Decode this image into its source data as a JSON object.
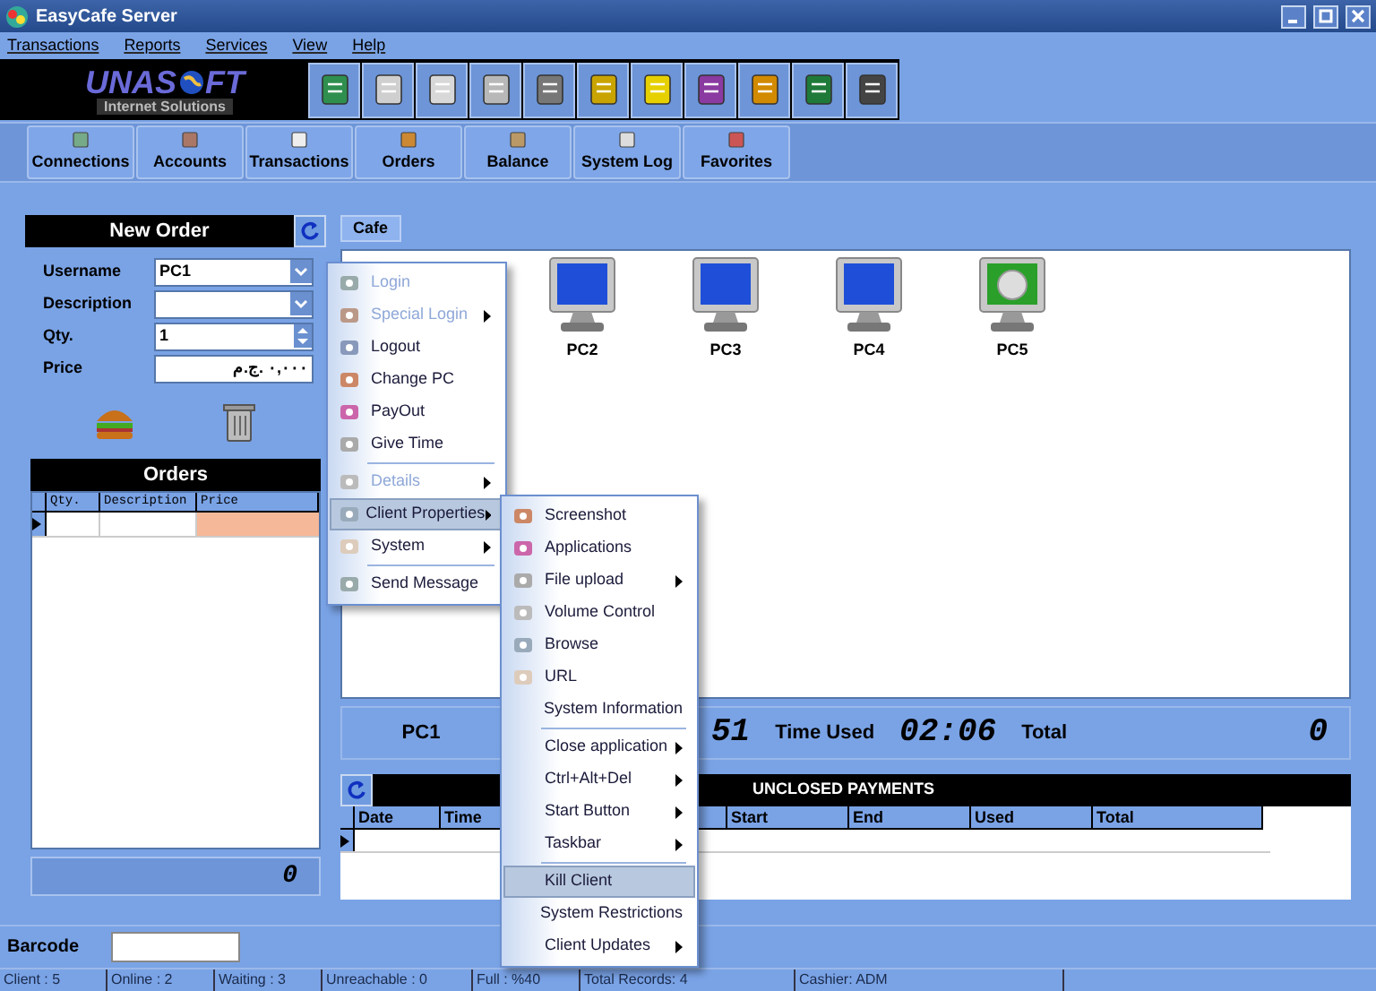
{
  "window": {
    "title": "EasyCafe Server"
  },
  "menu_bar": [
    "Transactions",
    "Reports",
    "Services",
    "View",
    "Help"
  ],
  "logo": {
    "left": "UNAS",
    "right": "FT",
    "tagline": "Internet Solutions"
  },
  "nav_tabs": [
    "Connections",
    "Accounts",
    "Transactions",
    "Orders",
    "Balance",
    "System Log",
    "Favorites"
  ],
  "new_order": {
    "title": "New Order",
    "fields": [
      {
        "label": "Username",
        "value": "PC1",
        "kind": "dropdown"
      },
      {
        "label": "Description",
        "kind": "dropdown"
      },
      {
        "label": "Qty.",
        "value": "1",
        "kind": "spinner"
      },
      {
        "label": "Price",
        "value": "٠,٠٠٠ .ج.م",
        "kind": "text"
      }
    ]
  },
  "orders": {
    "title": "Orders",
    "columns": [
      "Qty.",
      "Description",
      "Price"
    ],
    "total": "0"
  },
  "barcode": {
    "label": "Barcode"
  },
  "cafe": {
    "tab": "Cafe",
    "computers": [
      {
        "name": "PC2",
        "kind": "idle"
      },
      {
        "name": "PC3",
        "kind": "idle"
      },
      {
        "name": "PC4",
        "kind": "idle"
      },
      {
        "name": "PC5",
        "kind": "timer"
      }
    ]
  },
  "info_bar": {
    "name": "PC1",
    "time_partial": "51",
    "time_used_label": "Time Used",
    "time_used": "02:06",
    "total_label": "Total",
    "total": "0"
  },
  "unclosed_payments": {
    "title": "UNCLOSED PAYMENTS",
    "columns": [
      {
        "label": "Date"
      },
      {
        "label": "Time"
      },
      {
        "label": "Start"
      },
      {
        "label": "End"
      },
      {
        "label": "Used"
      },
      {
        "label": "Total"
      }
    ]
  },
  "context_menu": [
    {
      "kind": "item",
      "label": "Login",
      "disabled": true,
      "submenu": false,
      "selected": false
    },
    {
      "kind": "item",
      "label": "Special Login",
      "disabled": true,
      "submenu": true,
      "selected": false
    },
    {
      "kind": "item",
      "label": "Logout",
      "disabled": false,
      "submenu": false,
      "selected": false
    },
    {
      "kind": "item",
      "label": "Change PC",
      "disabled": false,
      "submenu": false,
      "selected": false
    },
    {
      "kind": "item",
      "label": "PayOut",
      "disabled": false,
      "submenu": false,
      "selected": false
    },
    {
      "kind": "item",
      "label": "Give Time",
      "disabled": false,
      "submenu": false,
      "selected": false
    },
    {
      "kind": "separator"
    },
    {
      "kind": "item",
      "label": "Details",
      "disabled": true,
      "submenu": true,
      "selected": false
    },
    {
      "kind": "item",
      "label": "Client Properties",
      "disabled": false,
      "submenu": true,
      "selected": true
    },
    {
      "kind": "item",
      "label": "System",
      "disabled": false,
      "submenu": true,
      "selected": false
    },
    {
      "kind": "separator"
    },
    {
      "kind": "item",
      "label": "Send Message",
      "disabled": false,
      "submenu": false,
      "selected": false
    }
  ],
  "submenu": [
    {
      "kind": "item",
      "label": "Screenshot",
      "submenu": false,
      "selected": false
    },
    {
      "kind": "item",
      "label": "Applications",
      "submenu": false,
      "selected": false
    },
    {
      "kind": "item",
      "label": "File upload",
      "submenu": true,
      "selected": false
    },
    {
      "kind": "item",
      "label": "Volume Control",
      "submenu": false,
      "selected": false
    },
    {
      "kind": "item",
      "label": "Browse",
      "submenu": false,
      "selected": false
    },
    {
      "kind": "item",
      "label": "URL",
      "submenu": false,
      "selected": false
    },
    {
      "kind": "item",
      "label": "System Information",
      "submenu": false,
      "selected": false
    },
    {
      "kind": "separator"
    },
    {
      "kind": "item",
      "label": "Close application",
      "submenu": true,
      "selected": false
    },
    {
      "kind": "item",
      "label": "Ctrl+Alt+Del",
      "submenu": true,
      "selected": false
    },
    {
      "kind": "item",
      "label": "Start Button",
      "submenu": true,
      "selected": false
    },
    {
      "kind": "item",
      "label": "Taskbar",
      "submenu": true,
      "selected": false
    },
    {
      "kind": "separator"
    },
    {
      "kind": "item",
      "label": "Kill Client",
      "submenu": false,
      "selected": true
    },
    {
      "kind": "item",
      "label": "System Restrictions",
      "submenu": false,
      "selected": false
    },
    {
      "kind": "item",
      "label": "Client Updates",
      "submenu": true,
      "selected": false
    }
  ],
  "status_bar": [
    "Client : 5",
    "Online : 2",
    "Waiting : 3",
    "Unreachable : 0",
    "Full : %40",
    "Total Records: 4",
    "Cashier: ADM"
  ]
}
